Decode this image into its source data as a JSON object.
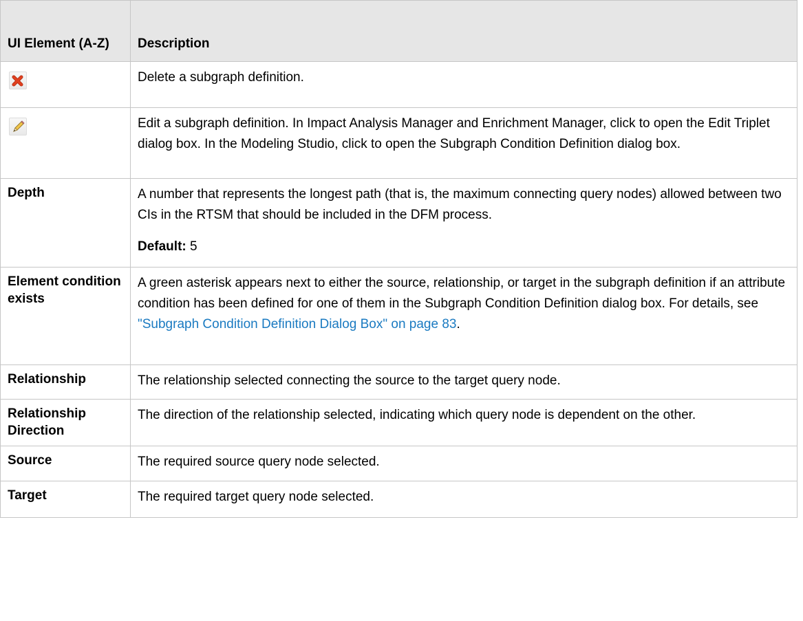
{
  "table": {
    "headers": [
      "UI Element (A-Z)",
      "Description"
    ],
    "rows": [
      {
        "element_icon": "delete-red-x-icon",
        "description": "Delete a subgraph definition."
      },
      {
        "element_icon": "edit-pencil-icon",
        "description": "Edit a subgraph definition. In Impact Analysis Manager and Enrichment Manager, click to open the Edit Triplet dialog box. In the Modeling Studio, click to open the Subgraph Condition Definition dialog box."
      },
      {
        "element": "Depth",
        "description": "A number that represents the longest path (that is, the maximum connecting query nodes) allowed between two CIs in the RTSM that should be included in the DFM process.",
        "note_label": "Default:",
        "note_value": " 5"
      },
      {
        "element": "Element condition exists",
        "description_before_link": "A green asterisk appears next to either the source, relationship, or target in the subgraph definition if an attribute condition has been defined for one of them in the Subgraph Condition Definition dialog box. For details, see ",
        "link_text": "\"Subgraph Condition Definition Dialog Box\" on page 83",
        "description_after_link": "."
      },
      {
        "element": "Relationship",
        "description": "The relationship selected connecting the source to the target query node."
      },
      {
        "element": "Relationship Direction",
        "description": "The direction of the relationship selected, indicating which query node is dependent on the other."
      },
      {
        "element": "Source",
        "description": "The required source query node selected."
      },
      {
        "element": "Target",
        "description": "The required target query node selected."
      }
    ]
  },
  "colors": {
    "header_bg": "#e6e6e6",
    "border": "#c6c6c6",
    "link": "#1a7ac1",
    "delete_icon": "#e0401f"
  }
}
